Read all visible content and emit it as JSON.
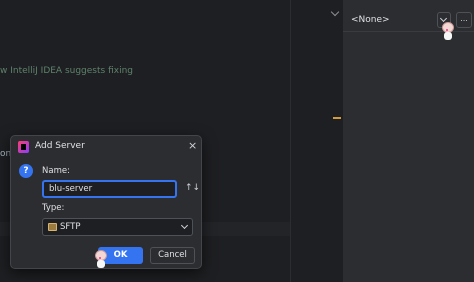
{
  "editor": {
    "hint_text": "w IntelliJ IDEA suggests fixing",
    "partial_text": "one",
    "warning_count": "1"
  },
  "right_panel": {
    "server_value": "<None>",
    "more_label": "..."
  },
  "dialog": {
    "title": "Add Server",
    "close_glyph": "×",
    "help_glyph": "?",
    "name_label": "Name:",
    "name_value": "blu-server",
    "sort_glyph": "↑↓",
    "type_label": "Type:",
    "type_value": "SFTP",
    "ok_label": "OK",
    "cancel_label": "Cancel"
  },
  "colors": {
    "accent": "#3574f0",
    "warning": "#e4a33b",
    "background": "#1e1f22",
    "panel": "#2b2d30"
  }
}
